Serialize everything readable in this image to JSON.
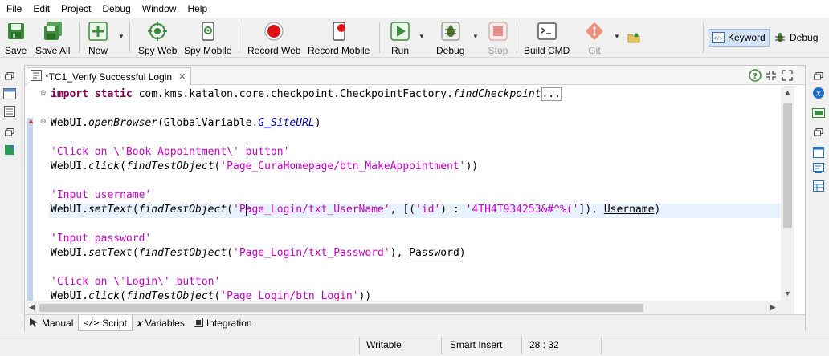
{
  "menu": [
    "File",
    "Edit",
    "Project",
    "Debug",
    "Window",
    "Help"
  ],
  "toolbar": {
    "save": "Save",
    "save_all": "Save All",
    "new": "New",
    "spy_web": "Spy Web",
    "spy_mobile": "Spy Mobile",
    "record_web": "Record Web",
    "record_mobile": "Record Mobile",
    "run": "Run",
    "debug": "Debug",
    "stop": "Stop",
    "build_cmd": "Build CMD",
    "git": "Git",
    "keyword": "Keyword",
    "debug_perspective": "Debug"
  },
  "editor": {
    "tab_title": "*TC1_Verify Successful Login",
    "lines": {
      "l1_kw": "import static",
      "l1_rest": " com.kms.katalon.core.checkpoint.CheckpointFactory.",
      "l1_method": "findCheckpoint",
      "l1_more": "...",
      "l2_a": "WebUI.",
      "l2_m": "openBrowser",
      "l2_b": "(GlobalVariable.",
      "l2_f": "G_SiteURL",
      "l2_c": ")",
      "l3": "'Click on \\'Book Appointment\\' button'",
      "l4_a": "WebUI.",
      "l4_m": "click",
      "l4_b": "(",
      "l4_m2": "findTestObject",
      "l4_c": "(",
      "l4_s": "'Page_CuraHomepage/btn_MakeAppointment'",
      "l4_d": "))",
      "l5": "'Input username'",
      "l6_a": "WebUI.",
      "l6_m": "setText",
      "l6_b": "(",
      "l6_m2": "findTestObject",
      "l6_c": "(",
      "l6_s1": "'P",
      "l6_s2": "age_Login/txt_UserName'",
      "l6_d": ", [(",
      "l6_s3": "'id'",
      "l6_e": ") : ",
      "l6_s4": "'4TH4T934253&#^%('",
      "l6_f": "]), ",
      "l6_v": "Username",
      "l6_g": ")",
      "l7": "'Input password'",
      "l8_a": "WebUI.",
      "l8_m": "setText",
      "l8_b": "(",
      "l8_m2": "findTestObject",
      "l8_c": "(",
      "l8_s": "'Page_Login/txt_Password'",
      "l8_d": "), ",
      "l8_v": "Password",
      "l8_e": ")",
      "l9": "'Click on \\'Login\\' button'",
      "l10_a": "WebUI.",
      "l10_m": "click",
      "l10_b": "(",
      "l10_m2": "findTestObject",
      "l10_c": "(",
      "l10_s": "'Page_Login/btn_Login'",
      "l10_d": "))"
    }
  },
  "bottom_tabs": {
    "manual": "Manual",
    "script": "Script",
    "variables": "Variables",
    "integration": "Integration"
  },
  "status": {
    "writable": "Writable",
    "insert_mode": "Smart Insert",
    "position": "28 : 32"
  },
  "colors": {
    "keyword": "#7f0055",
    "string": "#c800c8",
    "field": "#0000c0",
    "current_line": "#e8f2fe",
    "perspective_active": "#d5e4f5"
  }
}
